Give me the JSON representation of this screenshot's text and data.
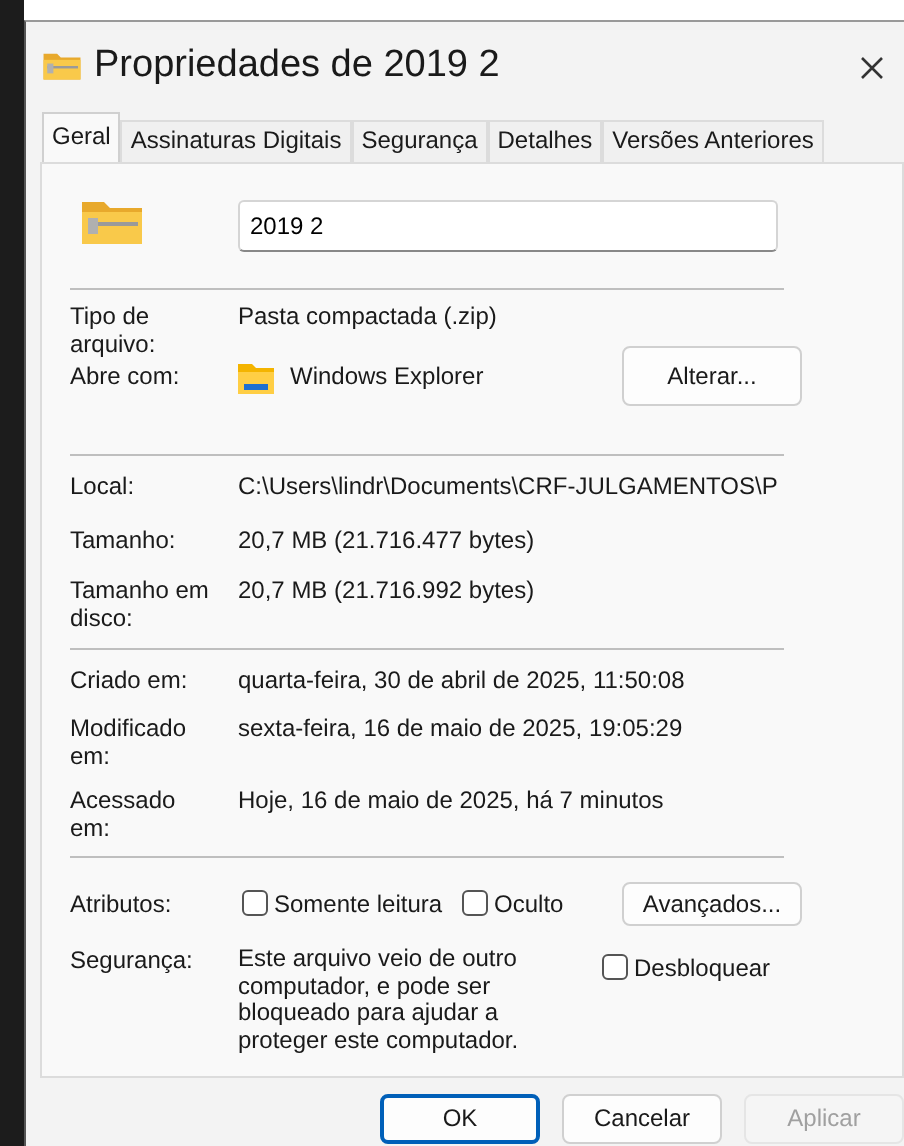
{
  "window": {
    "title": "Propriedades de 2019 2"
  },
  "tabs": [
    {
      "label": "Geral",
      "selected": true
    },
    {
      "label": "Assinaturas Digitais",
      "selected": false
    },
    {
      "label": "Segurança",
      "selected": false
    },
    {
      "label": "Detalhes",
      "selected": false
    },
    {
      "label": "Versões Anteriores",
      "selected": false
    }
  ],
  "name_field": {
    "value": "2019 2"
  },
  "sections": [
    {
      "rows": [
        {
          "label": "Tipo de arquivo:",
          "value": "Pasta compactada (.zip)"
        },
        {
          "label": "Abre com:",
          "value": "Windows Explorer",
          "kind": "app",
          "button": "Alterar..."
        }
      ]
    },
    {
      "rows": [
        {
          "label": "Local:",
          "value": "C:\\Users\\lindr\\Documents\\CRF-JULGAMENTOS\\P"
        },
        {
          "label": "Tamanho:",
          "value": "20,7 MB (21.716.477 bytes)"
        },
        {
          "label": "Tamanho em disco:",
          "value": "20,7 MB (21.716.992 bytes)"
        }
      ]
    },
    {
      "rows": [
        {
          "label": "Criado em:",
          "value": "quarta-feira, 30 de abril de 2025, 11:50:08"
        },
        {
          "label": "Modificado em:",
          "value": "sexta-feira, 16 de maio de 2025, 19:05:29"
        },
        {
          "label": "Acessado em:",
          "value": "Hoje, 16 de maio de 2025, há 7 minutos"
        }
      ]
    }
  ],
  "attributes": {
    "label": "Atributos:",
    "checkboxes": [
      {
        "label": "Somente leitura",
        "checked": false
      },
      {
        "label": "Oculto",
        "checked": false
      }
    ],
    "button": "Avançados..."
  },
  "security": {
    "label": "Segurança:",
    "text": "Este arquivo veio de outro computador, e pode ser bloqueado para ajudar a proteger este computador.",
    "checkbox": {
      "label": "Desbloquear",
      "checked": false
    }
  },
  "buttons": [
    {
      "label": "OK",
      "default": true,
      "disabled": false
    },
    {
      "label": "Cancelar",
      "default": false,
      "disabled": false
    },
    {
      "label": "Aplicar",
      "default": false,
      "disabled": true
    }
  ]
}
